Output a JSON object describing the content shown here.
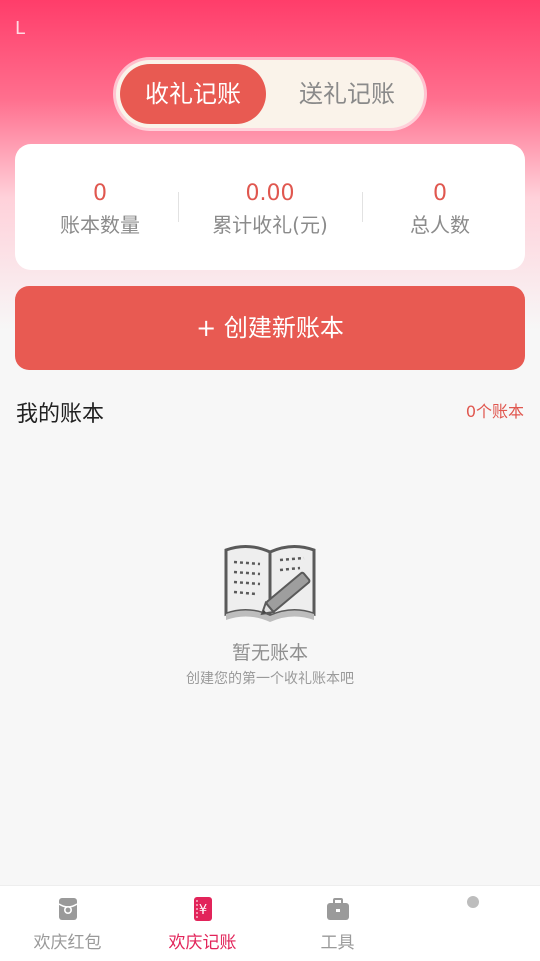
{
  "status": {
    "left_glyph": "L"
  },
  "toggle": {
    "active": "收礼记账",
    "inactive": "送礼记账"
  },
  "stats": [
    {
      "value": "0",
      "label": "账本数量"
    },
    {
      "value": "0.00",
      "label": "累计收礼(元)"
    },
    {
      "value": "0",
      "label": "总人数"
    }
  ],
  "create_button": "+ 创建新账本",
  "section": {
    "title": "我的账本",
    "count": "0个账本"
  },
  "empty": {
    "icon": "open-book-pencil-icon",
    "title": "暂无账本",
    "subtitle": "创建您的第一个收礼账本吧"
  },
  "tabs": [
    {
      "label": "欢庆红包",
      "icon": "red-envelope-icon"
    },
    {
      "label": "欢庆记账",
      "icon": "ledger-icon",
      "active": true
    },
    {
      "label": "工具",
      "icon": "toolbox-icon"
    },
    {
      "label": "",
      "icon": "dot-icon"
    }
  ],
  "colors": {
    "accent": "#e85a52",
    "tab_active": "#e2245a",
    "top_gradient": "#ff3d6a"
  }
}
